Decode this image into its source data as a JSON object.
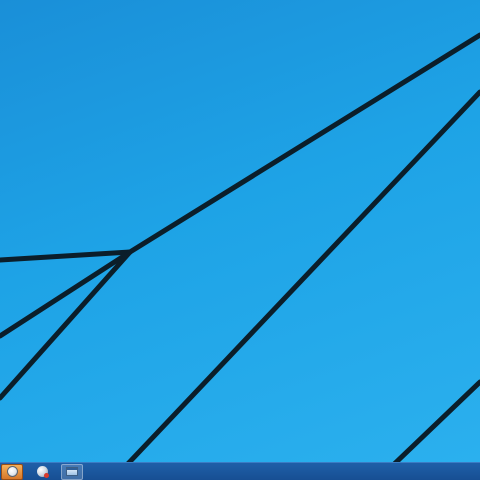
{
  "desktop": {
    "wallpaper": "windows-8-1-default",
    "colors": {
      "background": "#1ea3e6",
      "line": "#0b1e2a"
    }
  },
  "taskbar": {
    "color": "#174f93",
    "items": [
      {
        "name": "start-orb",
        "icon": "start-orb-icon"
      },
      {
        "name": "browser",
        "icon": "browser-icon"
      },
      {
        "name": "explorer-window",
        "icon": "window-icon",
        "active": true
      }
    ]
  }
}
